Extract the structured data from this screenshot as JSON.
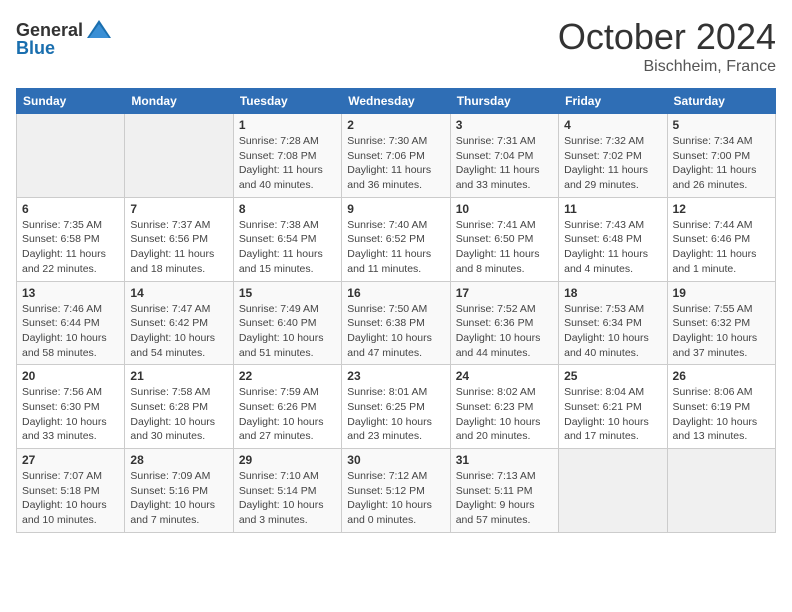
{
  "header": {
    "logo_general": "General",
    "logo_blue": "Blue",
    "month": "October 2024",
    "location": "Bischheim, France"
  },
  "days_of_week": [
    "Sunday",
    "Monday",
    "Tuesday",
    "Wednesday",
    "Thursday",
    "Friday",
    "Saturday"
  ],
  "weeks": [
    [
      {
        "day": "",
        "sunrise": "",
        "sunset": "",
        "daylight": ""
      },
      {
        "day": "",
        "sunrise": "",
        "sunset": "",
        "daylight": ""
      },
      {
        "day": "1",
        "sunrise": "Sunrise: 7:28 AM",
        "sunset": "Sunset: 7:08 PM",
        "daylight": "Daylight: 11 hours and 40 minutes."
      },
      {
        "day": "2",
        "sunrise": "Sunrise: 7:30 AM",
        "sunset": "Sunset: 7:06 PM",
        "daylight": "Daylight: 11 hours and 36 minutes."
      },
      {
        "day": "3",
        "sunrise": "Sunrise: 7:31 AM",
        "sunset": "Sunset: 7:04 PM",
        "daylight": "Daylight: 11 hours and 33 minutes."
      },
      {
        "day": "4",
        "sunrise": "Sunrise: 7:32 AM",
        "sunset": "Sunset: 7:02 PM",
        "daylight": "Daylight: 11 hours and 29 minutes."
      },
      {
        "day": "5",
        "sunrise": "Sunrise: 7:34 AM",
        "sunset": "Sunset: 7:00 PM",
        "daylight": "Daylight: 11 hours and 26 minutes."
      }
    ],
    [
      {
        "day": "6",
        "sunrise": "Sunrise: 7:35 AM",
        "sunset": "Sunset: 6:58 PM",
        "daylight": "Daylight: 11 hours and 22 minutes."
      },
      {
        "day": "7",
        "sunrise": "Sunrise: 7:37 AM",
        "sunset": "Sunset: 6:56 PM",
        "daylight": "Daylight: 11 hours and 18 minutes."
      },
      {
        "day": "8",
        "sunrise": "Sunrise: 7:38 AM",
        "sunset": "Sunset: 6:54 PM",
        "daylight": "Daylight: 11 hours and 15 minutes."
      },
      {
        "day": "9",
        "sunrise": "Sunrise: 7:40 AM",
        "sunset": "Sunset: 6:52 PM",
        "daylight": "Daylight: 11 hours and 11 minutes."
      },
      {
        "day": "10",
        "sunrise": "Sunrise: 7:41 AM",
        "sunset": "Sunset: 6:50 PM",
        "daylight": "Daylight: 11 hours and 8 minutes."
      },
      {
        "day": "11",
        "sunrise": "Sunrise: 7:43 AM",
        "sunset": "Sunset: 6:48 PM",
        "daylight": "Daylight: 11 hours and 4 minutes."
      },
      {
        "day": "12",
        "sunrise": "Sunrise: 7:44 AM",
        "sunset": "Sunset: 6:46 PM",
        "daylight": "Daylight: 11 hours and 1 minute."
      }
    ],
    [
      {
        "day": "13",
        "sunrise": "Sunrise: 7:46 AM",
        "sunset": "Sunset: 6:44 PM",
        "daylight": "Daylight: 10 hours and 58 minutes."
      },
      {
        "day": "14",
        "sunrise": "Sunrise: 7:47 AM",
        "sunset": "Sunset: 6:42 PM",
        "daylight": "Daylight: 10 hours and 54 minutes."
      },
      {
        "day": "15",
        "sunrise": "Sunrise: 7:49 AM",
        "sunset": "Sunset: 6:40 PM",
        "daylight": "Daylight: 10 hours and 51 minutes."
      },
      {
        "day": "16",
        "sunrise": "Sunrise: 7:50 AM",
        "sunset": "Sunset: 6:38 PM",
        "daylight": "Daylight: 10 hours and 47 minutes."
      },
      {
        "day": "17",
        "sunrise": "Sunrise: 7:52 AM",
        "sunset": "Sunset: 6:36 PM",
        "daylight": "Daylight: 10 hours and 44 minutes."
      },
      {
        "day": "18",
        "sunrise": "Sunrise: 7:53 AM",
        "sunset": "Sunset: 6:34 PM",
        "daylight": "Daylight: 10 hours and 40 minutes."
      },
      {
        "day": "19",
        "sunrise": "Sunrise: 7:55 AM",
        "sunset": "Sunset: 6:32 PM",
        "daylight": "Daylight: 10 hours and 37 minutes."
      }
    ],
    [
      {
        "day": "20",
        "sunrise": "Sunrise: 7:56 AM",
        "sunset": "Sunset: 6:30 PM",
        "daylight": "Daylight: 10 hours and 33 minutes."
      },
      {
        "day": "21",
        "sunrise": "Sunrise: 7:58 AM",
        "sunset": "Sunset: 6:28 PM",
        "daylight": "Daylight: 10 hours and 30 minutes."
      },
      {
        "day": "22",
        "sunrise": "Sunrise: 7:59 AM",
        "sunset": "Sunset: 6:26 PM",
        "daylight": "Daylight: 10 hours and 27 minutes."
      },
      {
        "day": "23",
        "sunrise": "Sunrise: 8:01 AM",
        "sunset": "Sunset: 6:25 PM",
        "daylight": "Daylight: 10 hours and 23 minutes."
      },
      {
        "day": "24",
        "sunrise": "Sunrise: 8:02 AM",
        "sunset": "Sunset: 6:23 PM",
        "daylight": "Daylight: 10 hours and 20 minutes."
      },
      {
        "day": "25",
        "sunrise": "Sunrise: 8:04 AM",
        "sunset": "Sunset: 6:21 PM",
        "daylight": "Daylight: 10 hours and 17 minutes."
      },
      {
        "day": "26",
        "sunrise": "Sunrise: 8:06 AM",
        "sunset": "Sunset: 6:19 PM",
        "daylight": "Daylight: 10 hours and 13 minutes."
      }
    ],
    [
      {
        "day": "27",
        "sunrise": "Sunrise: 7:07 AM",
        "sunset": "Sunset: 5:18 PM",
        "daylight": "Daylight: 10 hours and 10 minutes."
      },
      {
        "day": "28",
        "sunrise": "Sunrise: 7:09 AM",
        "sunset": "Sunset: 5:16 PM",
        "daylight": "Daylight: 10 hours and 7 minutes."
      },
      {
        "day": "29",
        "sunrise": "Sunrise: 7:10 AM",
        "sunset": "Sunset: 5:14 PM",
        "daylight": "Daylight: 10 hours and 3 minutes."
      },
      {
        "day": "30",
        "sunrise": "Sunrise: 7:12 AM",
        "sunset": "Sunset: 5:12 PM",
        "daylight": "Daylight: 10 hours and 0 minutes."
      },
      {
        "day": "31",
        "sunrise": "Sunrise: 7:13 AM",
        "sunset": "Sunset: 5:11 PM",
        "daylight": "Daylight: 9 hours and 57 minutes."
      },
      {
        "day": "",
        "sunrise": "",
        "sunset": "",
        "daylight": ""
      },
      {
        "day": "",
        "sunrise": "",
        "sunset": "",
        "daylight": ""
      }
    ]
  ]
}
